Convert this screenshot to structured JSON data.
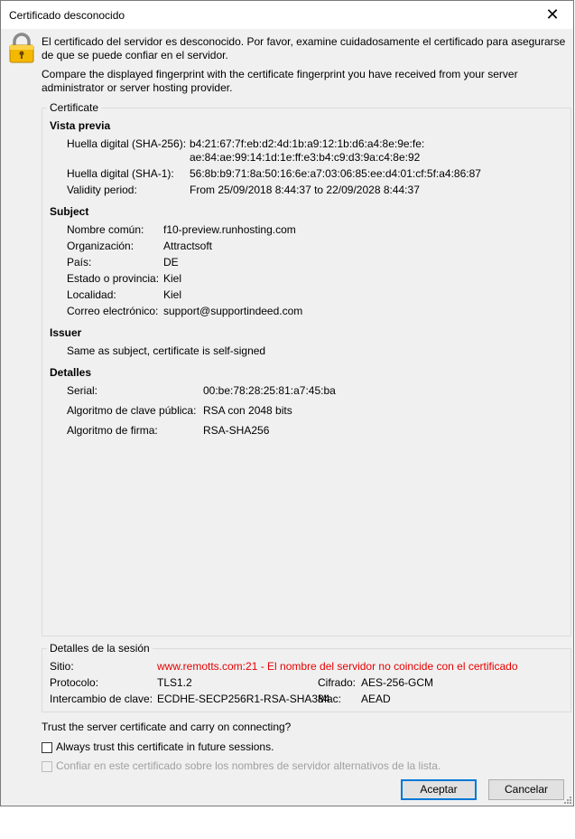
{
  "window": {
    "title": "Certificado desconocido"
  },
  "intro": {
    "warning": "El certificado del servidor es desconocido. Por favor, examine cuidadosamente el certificado para asegurarse de que se puede confiar en el servidor.",
    "compare": "Compare the displayed fingerprint with the certificate fingerprint you have received from your server administrator or server hosting provider."
  },
  "certificate": {
    "legend": "Certificate",
    "preview": {
      "heading": "Vista previa",
      "sha256_label": "Huella digital (SHA-256):",
      "sha256_line1": "b4:21:67:7f:eb:d2:4d:1b:a9:12:1b:d6:a4:8e:9e:fe:",
      "sha256_line2": "ae:84:ae:99:14:1d:1e:ff:e3:b4:c9:d3:9a:c4:8e:92",
      "sha1_label": "Huella digital (SHA-1):",
      "sha1_value": "56:8b:b9:71:8a:50:16:6e:a7:03:06:85:ee:d4:01:cf:5f:a4:86:87",
      "validity_label": "Validity period:",
      "validity_value": "From 25/09/2018 8:44:37 to 22/09/2028 8:44:37"
    },
    "subject": {
      "heading": "Subject",
      "rows": [
        {
          "label": "Nombre común:",
          "value": "f10-preview.runhosting.com"
        },
        {
          "label": "Organización:",
          "value": "Attractsoft"
        },
        {
          "label": "País:",
          "value": "DE"
        },
        {
          "label": "Estado o provincia:",
          "value": "Kiel"
        },
        {
          "label": "Localidad:",
          "value": "Kiel"
        },
        {
          "label": "Correo electrónico:",
          "value": "support@supportindeed.com"
        }
      ]
    },
    "issuer": {
      "heading": "Issuer",
      "text": "Same as subject, certificate is self-signed"
    },
    "details": {
      "heading": "Detalles",
      "rows": [
        {
          "label": "Serial:",
          "value": "00:be:78:28:25:81:a7:45:ba"
        },
        {
          "label": "Algoritmo de clave pública:",
          "value": "RSA con 2048 bits"
        },
        {
          "label": "Algoritmo de firma:",
          "value": "RSA-SHA256"
        }
      ]
    }
  },
  "session": {
    "legend": "Detalles de la sesión",
    "site_label": "Sitio:",
    "site_value": "www.remotts.com:21 - El nombre del servidor no coincide con el certificado",
    "protocol_label": "Protocolo:",
    "protocol_value": "TLS1.2",
    "cipher_label": "Cifrado:",
    "cipher_value": "AES-256-GCM",
    "kex_label": "Intercambio de clave:",
    "kex_value": "ECDHE-SECP256R1-RSA-SHA384",
    "mac_label": "Mac:",
    "mac_value": "AEAD"
  },
  "trust": {
    "question": "Trust the server certificate and carry on connecting?",
    "always_trust": "Always trust this certificate in future sessions.",
    "trust_alt_names": "Confiar en este certificado sobre los nombres de servidor alternativos de la lista."
  },
  "buttons": {
    "accept": "Aceptar",
    "cancel": "Cancelar"
  },
  "colors": {
    "error_text": "#e60000",
    "focus_border": "#0078d7",
    "lock_body": "#f5b800"
  },
  "icons": {
    "lock": "padlock-icon",
    "close": "close-icon"
  }
}
